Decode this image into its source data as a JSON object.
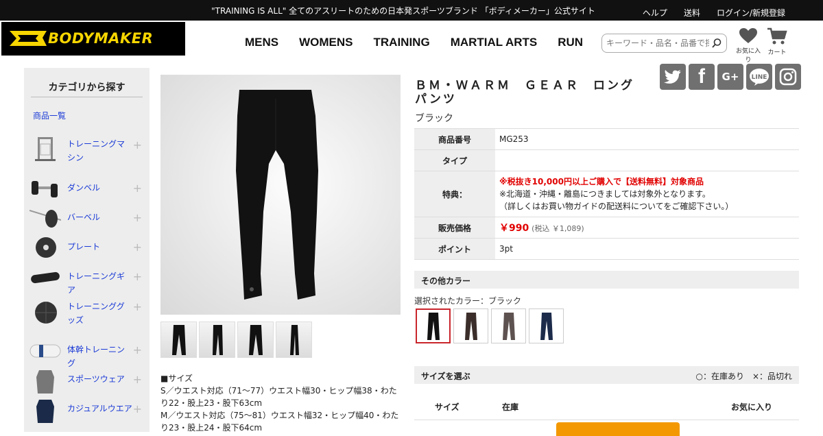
{
  "topbar": {
    "message": "\"TRAINING IS ALL\" 全てのアスリートのための日本発スポーツブランド 「ボディメーカー」公式サイト",
    "links": [
      "ヘルプ",
      "送料",
      "ログイン/新規登録"
    ]
  },
  "brand": {
    "name": "BODYMAKER",
    "accent": "#f6d500"
  },
  "nav": [
    "MENS",
    "WOMENS",
    "TRAINING",
    "MARTIAL ARTS",
    "RUN"
  ],
  "search": {
    "placeholder": "キーワード・品名・品番で探す"
  },
  "header_icons": {
    "favorites_label": "お気に入り",
    "cart_label": "カート"
  },
  "sidebar": {
    "title": "カテゴリから探す",
    "all_link": "商品一覧",
    "items": [
      {
        "label": "トレーニングマシン",
        "icon": "machine-icon"
      },
      {
        "label": "ダンベル",
        "icon": "dumbbell-icon"
      },
      {
        "label": "バーベル",
        "icon": "barbell-icon"
      },
      {
        "label": "プレート",
        "icon": "plate-icon"
      },
      {
        "label": "トレーニングギア",
        "icon": "gear-icon"
      },
      {
        "label": "トレーニンググッズ",
        "icon": "ball-icon"
      },
      {
        "label": "体幹トレーニング",
        "icon": "core-bag-icon"
      },
      {
        "label": "スポーツウェア",
        "icon": "sportswear-icon"
      },
      {
        "label": "カジュアルウエア",
        "icon": "casual-wear-icon"
      }
    ]
  },
  "product": {
    "title": "ＢＭ・ＷＡＲＭ　ＧＥＡＲ　ロングパンツ",
    "color": "ブラック",
    "specs": {
      "code_label": "商品番号",
      "code": "MG253",
      "type_label": "タイプ",
      "type": "",
      "bonus_label": "特典：",
      "bonus_line1": "※税抜き10,000円以上ご購入で【送料無料】対象商品",
      "bonus_line2": "※北海道・沖縄・離島につきましては対象外となります。",
      "bonus_line3": "（詳しくはお買い物ガイドの配送料についてをご確認下さい。）",
      "price_label": "販売価格",
      "price": "￥990",
      "price_tax": "(税込 ￥1,089)",
      "points_label": "ポイント",
      "points": "3pt"
    },
    "other_colors_title": "その他カラー",
    "selected_color_text": "選択されたカラー：ブラック",
    "swatch_colors": [
      "#111111",
      "#3b2e2a",
      "#5e5250",
      "#1c2b4a"
    ],
    "size_section_title": "サイズを選ぶ",
    "size_legend": "○：在庫あり　×：品切れ",
    "size_headers": [
      "サイズ",
      "在庫",
      "お気に入り"
    ],
    "description": [
      "■サイズ",
      "S／ウエスト対応（71～77）ウエスト幅30・ヒップ幅38・わたり22・股上23・股下63cm",
      "M／ウエスト対応（75～81）ウエスト幅32・ヒップ幅40・わたり23・股上24・股下64cm"
    ]
  },
  "social": [
    "twitter-icon",
    "facebook-icon",
    "google-plus-icon",
    "line-icon",
    "instagram-icon"
  ]
}
